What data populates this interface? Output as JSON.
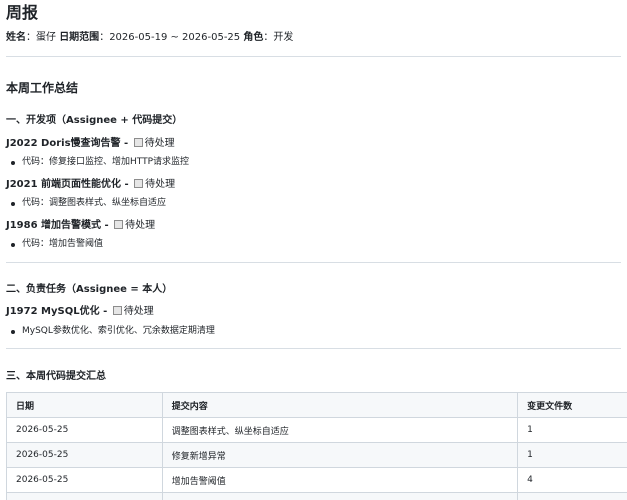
{
  "title": "周报",
  "meta": {
    "name_label": "姓名",
    "name": "蛋仔",
    "range_label": "日期范围",
    "range": "2026-05-19 ~ 2026-05-25",
    "role_label": "角色",
    "role": "开发"
  },
  "summary_heading": "本周工作总结",
  "section1": {
    "heading": "一、开发项（Assignee + 代码提交）",
    "items": [
      {
        "id": "J2022 Doris慢查询告警",
        "status": "待处理",
        "code": "代码：修复接口监控、增加HTTP请求监控"
      },
      {
        "id": "J2021 前端页面性能优化",
        "status": "待处理",
        "code": "代码：调整图表样式、纵坐标自适应"
      },
      {
        "id": "J1986 增加告警模式",
        "status": "待处理",
        "code": "代码：增加告警阈值"
      }
    ]
  },
  "section2": {
    "heading": "二、负责任务（Assignee = 本人）",
    "items": [
      {
        "id": "J1972 MySQL优化",
        "status": "待处理",
        "desc": "MySQL参数优化、索引优化、冗余数据定期清理"
      }
    ]
  },
  "section3": {
    "heading": "三、本周代码提交汇总",
    "columns": [
      "日期",
      "提交内容",
      "变更文件数"
    ],
    "rows": [
      [
        "2026-05-25",
        "调整图表样式、纵坐标自适应",
        "1"
      ],
      [
        "2026-05-25",
        "修复新增异常",
        "1"
      ],
      [
        "2026-05-25",
        "增加告警阈值",
        "4"
      ]
    ]
  }
}
